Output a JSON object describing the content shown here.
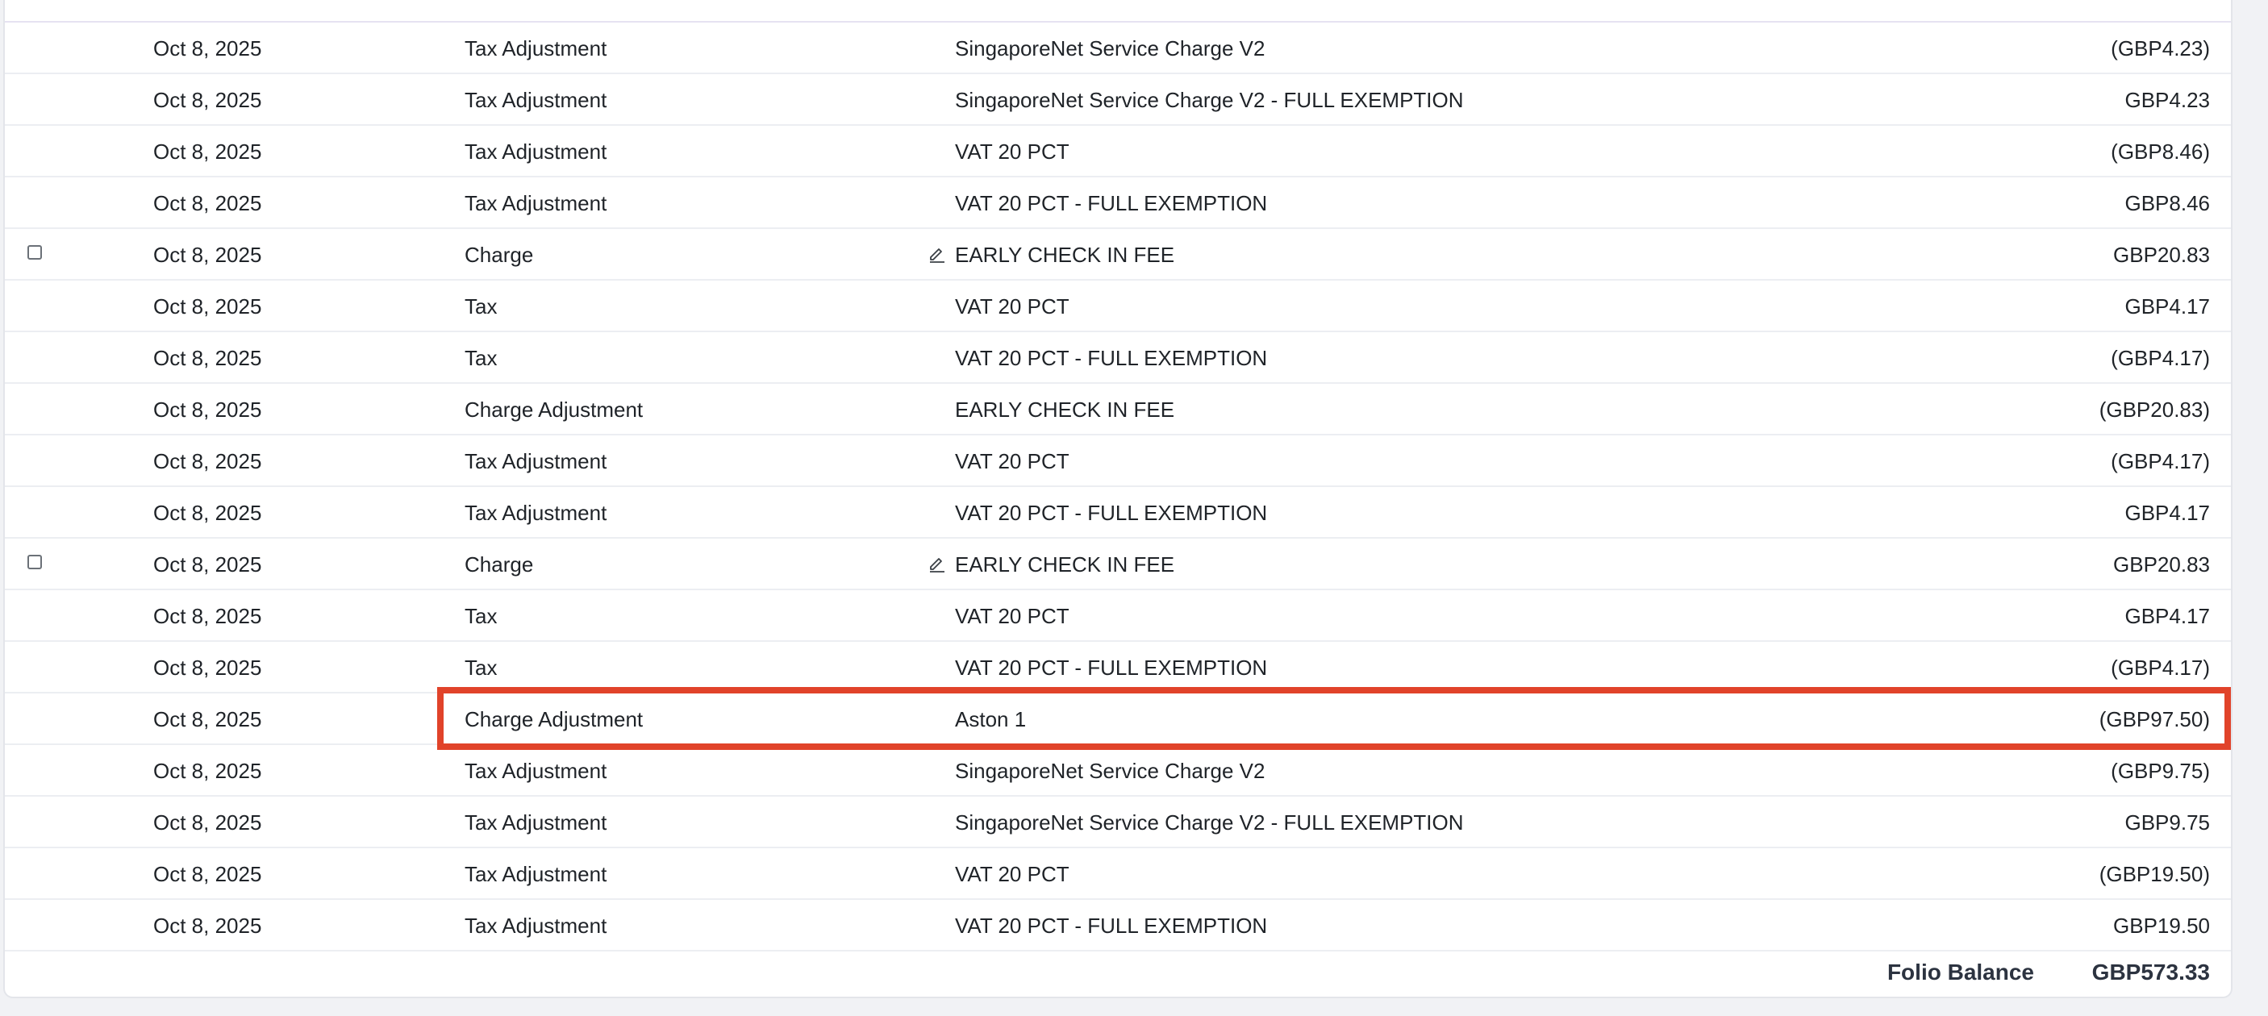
{
  "ledger": {
    "rows": [
      {
        "date": "Oct 8, 2025",
        "type": "Tax Adjustment",
        "description": "SingaporeNet Service Charge V2",
        "amount": "(GBP4.23)"
      },
      {
        "date": "Oct 8, 2025",
        "type": "Tax Adjustment",
        "description": "SingaporeNet Service Charge V2 - FULL EXEMPTION",
        "amount": "GBP4.23"
      },
      {
        "date": "Oct 8, 2025",
        "type": "Tax Adjustment",
        "description": "VAT 20 PCT",
        "amount": "(GBP8.46)"
      },
      {
        "date": "Oct 8, 2025",
        "type": "Tax Adjustment",
        "description": "VAT 20 PCT - FULL EXEMPTION",
        "amount": "GBP8.46"
      },
      {
        "date": "Oct 8, 2025",
        "type": "Charge",
        "description": "EARLY CHECK IN FEE",
        "amount": "GBP20.83",
        "checkbox": true,
        "editable": true
      },
      {
        "date": "Oct 8, 2025",
        "type": "Tax",
        "description": "VAT 20 PCT",
        "amount": "GBP4.17"
      },
      {
        "date": "Oct 8, 2025",
        "type": "Tax",
        "description": "VAT 20 PCT - FULL EXEMPTION",
        "amount": "(GBP4.17)"
      },
      {
        "date": "Oct 8, 2025",
        "type": "Charge Adjustment",
        "description": "EARLY CHECK IN FEE",
        "amount": "(GBP20.83)"
      },
      {
        "date": "Oct 8, 2025",
        "type": "Tax Adjustment",
        "description": "VAT 20 PCT",
        "amount": "(GBP4.17)"
      },
      {
        "date": "Oct 8, 2025",
        "type": "Tax Adjustment",
        "description": "VAT 20 PCT - FULL EXEMPTION",
        "amount": "GBP4.17"
      },
      {
        "date": "Oct 8, 2025",
        "type": "Charge",
        "description": "EARLY CHECK IN FEE",
        "amount": "GBP20.83",
        "checkbox": true,
        "editable": true
      },
      {
        "date": "Oct 8, 2025",
        "type": "Tax",
        "description": "VAT 20 PCT",
        "amount": "GBP4.17"
      },
      {
        "date": "Oct 8, 2025",
        "type": "Tax",
        "description": "VAT 20 PCT - FULL EXEMPTION",
        "amount": "(GBP4.17)"
      },
      {
        "date": "Oct 8, 2025",
        "type": "Charge Adjustment",
        "description": "Aston 1",
        "amount": "(GBP97.50)",
        "highlighted": true
      },
      {
        "date": "Oct 8, 2025",
        "type": "Tax Adjustment",
        "description": "SingaporeNet Service Charge V2",
        "amount": "(GBP9.75)"
      },
      {
        "date": "Oct 8, 2025",
        "type": "Tax Adjustment",
        "description": "SingaporeNet Service Charge V2 - FULL EXEMPTION",
        "amount": "GBP9.75"
      },
      {
        "date": "Oct 8, 2025",
        "type": "Tax Adjustment",
        "description": "VAT 20 PCT",
        "amount": "(GBP19.50)"
      },
      {
        "date": "Oct 8, 2025",
        "type": "Tax Adjustment",
        "description": "VAT 20 PCT - FULL EXEMPTION",
        "amount": "GBP19.50"
      }
    ]
  },
  "footer": {
    "balance_label": "Folio Balance",
    "balance_value": "GBP573.33"
  },
  "colors": {
    "highlight": "#e1432a",
    "row_divider": "#eceef2",
    "background": "#f1f2f5"
  },
  "icons": {
    "edit": "pencil-edit-icon"
  }
}
